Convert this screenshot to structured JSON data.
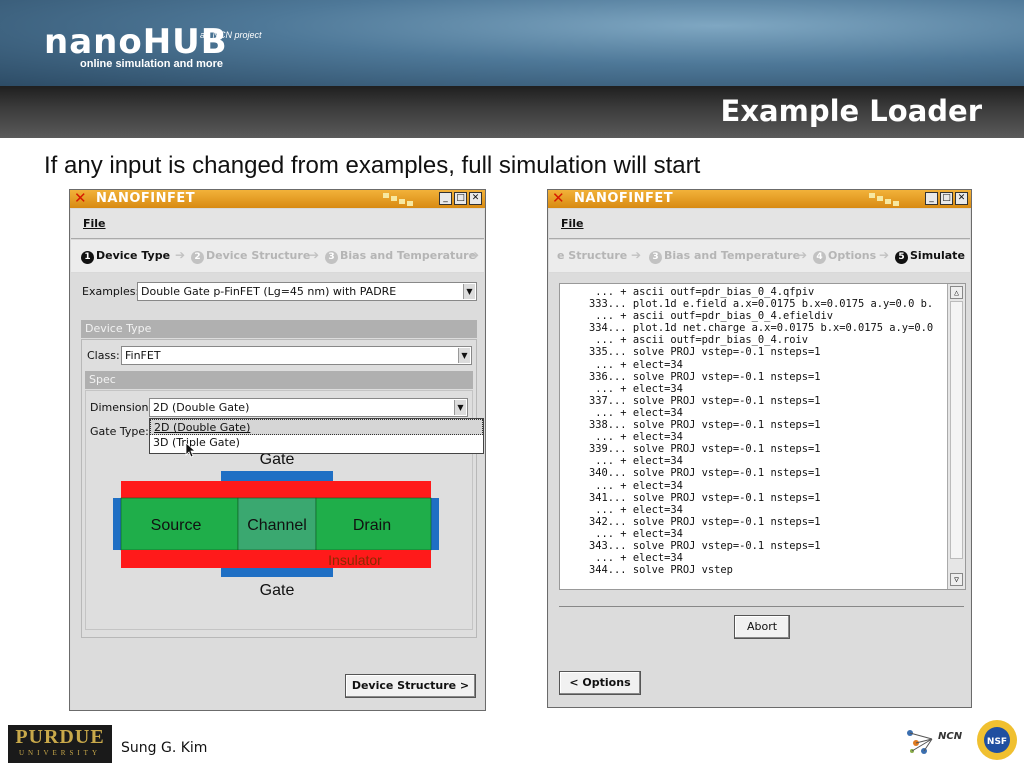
{
  "header": {
    "logo": "nanoHUB",
    "logo_sub": "online simulation and more",
    "ncn_tag": "an NCN project",
    "title": "Example Loader"
  },
  "subtitle": "If any input is changed from  examples, full simulation will start",
  "left_window": {
    "title": "NANOFINFET",
    "menu_file": "File",
    "steps": [
      {
        "num": "1",
        "label": "Device Type"
      },
      {
        "num": "2",
        "label": "Device Structure"
      },
      {
        "num": "3",
        "label": "Bias and Temperature"
      }
    ],
    "examples_label": "Examples:",
    "examples_value": "Double Gate p-FinFET (Lg=45 nm) with PADRE",
    "device_type_header": "Device Type",
    "class_label": "Class:",
    "class_value": "FinFET",
    "spec_header": "Spec",
    "dimension_label": "Dimension:",
    "dimension_value": "2D (Double Gate)",
    "gate_type_label": "Gate Type:",
    "dropdown_options": [
      "2D (Double Gate)",
      "3D (Triple Gate)"
    ],
    "diagram": {
      "gate_top": "Gate",
      "gate_bottom": "Gate",
      "source": "Source",
      "channel": "Channel",
      "drain": "Drain",
      "insulator": "Insulator"
    },
    "next_button": "Device Structure >"
  },
  "right_window": {
    "title": "NANOFINFET",
    "menu_file": "File",
    "steps": [
      {
        "num": "",
        "label": "e Structure"
      },
      {
        "num": "3",
        "label": "Bias and Temperature"
      },
      {
        "num": "4",
        "label": "Options"
      },
      {
        "num": "5",
        "label": "Simulate"
      }
    ],
    "log_lines": [
      "     ... + ascii outf=pdr_bias_0_4.qfpiv",
      "    333... plot.1d e.field a.x=0.0175 b.x=0.0175 a.y=0.0 b.",
      "     ... + ascii outf=pdr_bias_0_4.efieldiv",
      "    334... plot.1d net.charge a.x=0.0175 b.x=0.0175 a.y=0.0",
      "     ... + ascii outf=pdr_bias_0_4.roiv",
      "    335... solve PROJ vstep=-0.1 nsteps=1",
      "     ... + elect=34",
      "    336... solve PROJ vstep=-0.1 nsteps=1",
      "     ... + elect=34",
      "    337... solve PROJ vstep=-0.1 nsteps=1",
      "     ... + elect=34",
      "    338... solve PROJ vstep=-0.1 nsteps=1",
      "     ... + elect=34",
      "    339... solve PROJ vstep=-0.1 nsteps=1",
      "     ... + elect=34",
      "    340... solve PROJ vstep=-0.1 nsteps=1",
      "     ... + elect=34",
      "    341... solve PROJ vstep=-0.1 nsteps=1",
      "     ... + elect=34",
      "    342... solve PROJ vstep=-0.1 nsteps=1",
      "     ... + elect=34",
      "    343... solve PROJ vstep=-0.1 nsteps=1",
      "     ... + elect=34",
      "    344... solve PROJ vstep"
    ],
    "abort_button": "Abort",
    "back_button": "< Options"
  },
  "footer": {
    "university": "PURDUE",
    "university_sub": "UNIVERSITY",
    "author": "Sung G. Kim",
    "ncn": "NCN",
    "nsf": "NSF"
  },
  "colors": {
    "titlebar": "#e09a20",
    "gate_blue": "#1f6fc4",
    "insulator_red": "#ff1a1a",
    "region_green": "#1fae4a",
    "channel_green": "#3aa870"
  }
}
